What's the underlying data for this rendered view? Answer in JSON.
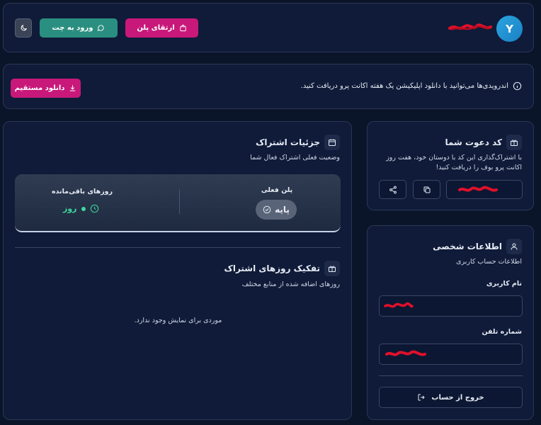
{
  "header": {
    "avatar_letter": "Y",
    "upgrade_label": "ارتقای پلن",
    "chat_label": "ورود به چت"
  },
  "notice": {
    "text": "اندرویدی‌ها می‌توانید با دانلود اپلیکیشن یک هفته اکانت پرو دریافت کنید.",
    "download_label": "دانلود مستقیم"
  },
  "subscription": {
    "title": "جزئیات اشتراک",
    "subtitle": "وضعیت فعلی اشتراک فعال شما",
    "current_plan_label": "پلن فعلی",
    "current_plan_value": "پایه",
    "remaining_label": "روزهای باقی‌مانده",
    "remaining_value": "روز",
    "breakdown_title": "تفکیک روزهای اشتراک",
    "breakdown_subtitle": "روزهای اضافه شده از منابع مختلف",
    "empty_text": "موردی برای نمایش وجود ندارد."
  },
  "invite": {
    "title": "کد دعوت شما",
    "description": "با اشتراک‌گذاری این کد با دوستان خود، هفت روز اکانت پرو بوف را دریافت کنید!"
  },
  "profile": {
    "title": "اطلاعات شخصی",
    "subtitle": "اطلاعات حساب کاربری",
    "username_label": "نام کاربری",
    "phone_label": "شماره تلفن",
    "logout_label": "خروج از حساب"
  },
  "colors": {
    "accent_pink": "#c8187a",
    "accent_teal": "#2a8f80",
    "success_green": "#3fd8a0",
    "redaction_red": "#e0102a"
  }
}
